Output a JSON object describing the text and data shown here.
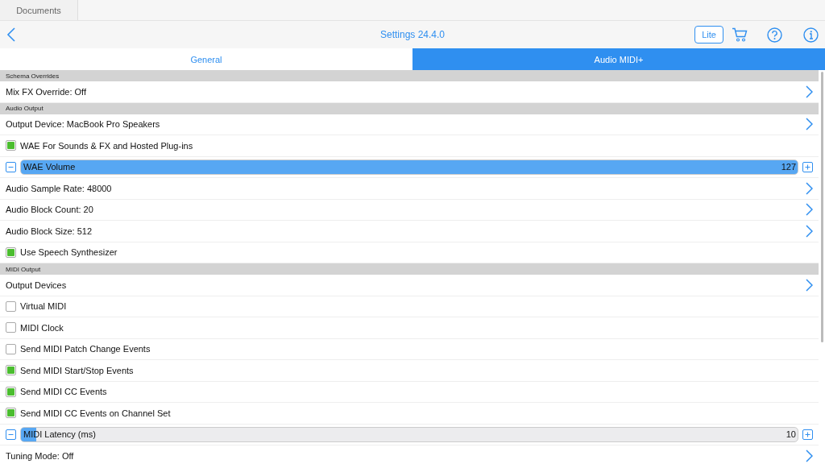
{
  "doc_tab": {
    "label": "Documents"
  },
  "nav": {
    "title": "Settings 24.4.0",
    "badge": "Lite"
  },
  "tabs": [
    {
      "label": "General",
      "selected": false
    },
    {
      "label": "Audio MIDI+",
      "selected": true
    }
  ],
  "sections": [
    {
      "header": "Schema Overrides",
      "items": [
        {
          "kind": "nav",
          "label": "Mix FX Override: Off"
        }
      ]
    },
    {
      "header": "Audio Output",
      "items": [
        {
          "kind": "nav",
          "label": "Output Device: MacBook Pro Speakers"
        },
        {
          "kind": "check",
          "label": "WAE For Sounds & FX and Hosted Plug-ins",
          "checked": true
        },
        {
          "kind": "slider",
          "label": "WAE Volume",
          "reading": "127",
          "level": 1.0
        },
        {
          "kind": "nav",
          "label": "Audio Sample Rate: 48000"
        },
        {
          "kind": "nav",
          "label": "Audio Block Count: 20"
        },
        {
          "kind": "nav",
          "label": "Audio Block Size: 512"
        },
        {
          "kind": "check",
          "label": "Use Speech Synthesizer",
          "checked": true
        }
      ]
    },
    {
      "header": "MIDI Output",
      "items": [
        {
          "kind": "nav",
          "label": "Output Devices"
        },
        {
          "kind": "check",
          "label": "Virtual MIDI",
          "checked": false
        },
        {
          "kind": "check",
          "label": "MIDI Clock",
          "checked": false
        },
        {
          "kind": "check",
          "label": "Send MIDI Patch Change Events",
          "checked": false
        },
        {
          "kind": "check",
          "label": "Send MIDI Start/Stop Events",
          "checked": true
        },
        {
          "kind": "check",
          "label": "Send MIDI CC Events",
          "checked": true
        },
        {
          "kind": "check",
          "label": "Send MIDI CC Events on Channel Set",
          "checked": true
        },
        {
          "kind": "slider",
          "label": "MIDI Latency (ms)",
          "reading": "10",
          "level": 0.02
        },
        {
          "kind": "nav",
          "label": "Tuning Mode: Off"
        }
      ]
    }
  ]
}
